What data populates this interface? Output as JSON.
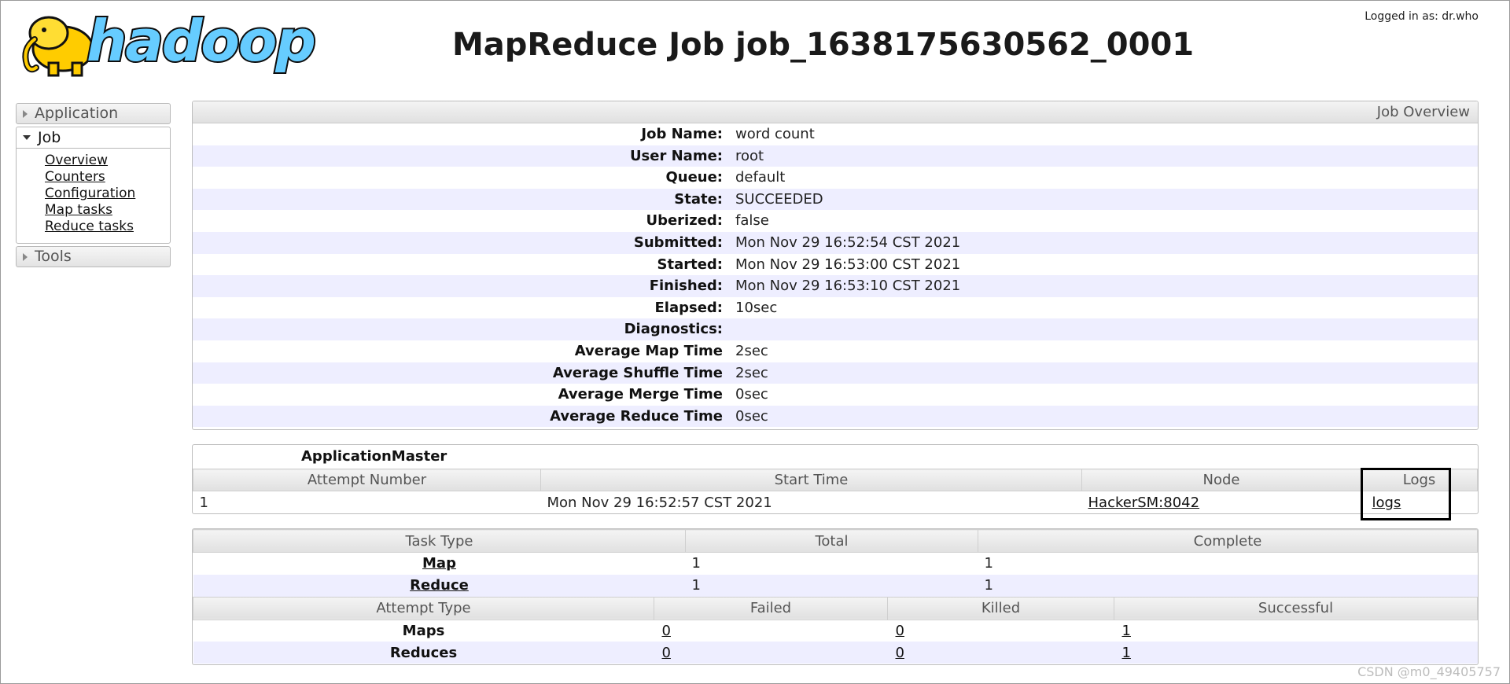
{
  "header": {
    "logo_text": "hadoop",
    "title": "MapReduce Job job_1638175630562_0001",
    "logged_in": "Logged in as: dr.who"
  },
  "sidebar": {
    "application": "Application",
    "job": "Job",
    "job_links": [
      "Overview",
      "Counters",
      "Configuration",
      "Map tasks",
      "Reduce tasks"
    ],
    "tools": "Tools"
  },
  "overview": {
    "title": "Job Overview",
    "rows": [
      {
        "label": "Job Name:",
        "value": "word count"
      },
      {
        "label": "User Name:",
        "value": "root"
      },
      {
        "label": "Queue:",
        "value": "default"
      },
      {
        "label": "State:",
        "value": "SUCCEEDED"
      },
      {
        "label": "Uberized:",
        "value": "false"
      },
      {
        "label": "Submitted:",
        "value": "Mon Nov 29 16:52:54 CST 2021"
      },
      {
        "label": "Started:",
        "value": "Mon Nov 29 16:53:00 CST 2021"
      },
      {
        "label": "Finished:",
        "value": "Mon Nov 29 16:53:10 CST 2021"
      },
      {
        "label": "Elapsed:",
        "value": "10sec"
      },
      {
        "label": "Diagnostics:",
        "value": ""
      },
      {
        "label": "Average Map Time",
        "value": "2sec"
      },
      {
        "label": "Average Shuffle Time",
        "value": "2sec"
      },
      {
        "label": "Average Merge Time",
        "value": "0sec"
      },
      {
        "label": "Average Reduce Time",
        "value": "0sec"
      }
    ]
  },
  "app_master": {
    "heading": "ApplicationMaster",
    "columns": [
      "Attempt Number",
      "Start Time",
      "Node",
      "Logs"
    ],
    "row": {
      "attempt": "1",
      "start": "Mon Nov 29 16:52:57 CST 2021",
      "node": "HackerSM:8042",
      "logs": "logs"
    }
  },
  "tasks": {
    "columns": [
      "Task Type",
      "Total",
      "Complete"
    ],
    "rows": [
      {
        "type": "Map",
        "total": "1",
        "complete": "1"
      },
      {
        "type": "Reduce",
        "total": "1",
        "complete": "1"
      }
    ]
  },
  "attempts": {
    "columns": [
      "Attempt Type",
      "Failed",
      "Killed",
      "Successful"
    ],
    "rows": [
      {
        "type": "Maps",
        "failed": "0",
        "killed": "0",
        "successful": "1"
      },
      {
        "type": "Reduces",
        "failed": "0",
        "killed": "0",
        "successful": "1"
      }
    ]
  },
  "watermark": "CSDN @m0_49405757"
}
